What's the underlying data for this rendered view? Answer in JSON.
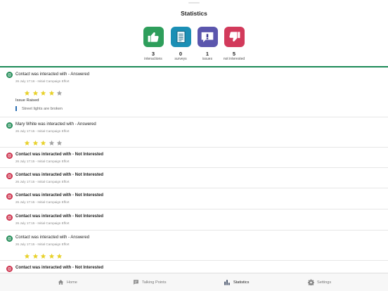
{
  "header": {
    "title": "Statistics"
  },
  "stats": [
    {
      "value": "3",
      "label": "interactions",
      "icon": "thumbs-up-icon",
      "color": "#2e9e5b"
    },
    {
      "value": "0",
      "label": "surveys",
      "icon": "document-icon",
      "color": "#1b8fb5"
    },
    {
      "value": "1",
      "label": "issues",
      "icon": "speech-bubble-icon",
      "color": "#5b56ad"
    },
    {
      "value": "5",
      "label": "not interested",
      "icon": "thumbs-down-icon",
      "color": "#d23a5b"
    }
  ],
  "feed": [
    {
      "headline": "Contact was interacted with - Answered",
      "meta": "26 July 17:16 - Initial Campaign Effort",
      "status": "answered",
      "rating": 4,
      "issue_label": "Issue Raised",
      "issue_text": "Street lights are broken"
    },
    {
      "headline": "Mary White was interacted with - Answered",
      "meta": "26 July 17:15 - Initial Campaign Effort",
      "status": "answered",
      "rating": 3
    },
    {
      "headline": "Contact was interacted with - Not Interested",
      "meta": "26 July 17:15 - Initial Campaign Effort",
      "status": "not-interested"
    },
    {
      "headline": "Contact was interacted with - Not Interested",
      "meta": "26 July 17:15 - Initial Campaign Effort",
      "status": "not-interested"
    },
    {
      "headline": "Contact was interacted with - Not Interested",
      "meta": "26 July 17:15 - Initial Campaign Effort",
      "status": "not-interested"
    },
    {
      "headline": "Contact was interacted with - Not Interested",
      "meta": "26 July 17:15 - Initial Campaign Effort",
      "status": "not-interested"
    },
    {
      "headline": "Contact was interacted with - Answered",
      "meta": "26 July 17:15 - Initial Campaign Effort",
      "status": "answered",
      "rating": 5
    },
    {
      "headline": "Contact was interacted with - Not Interested",
      "meta": "",
      "status": "not-interested"
    }
  ],
  "rating_max": 5,
  "colors": {
    "accent_green": "#1c8a57",
    "answered": "#1f8a55",
    "not_interested": "#cc2f4a",
    "star_on": "#e8d12a",
    "star_off": "#a3a3a3"
  },
  "tabs": [
    {
      "label": "Home",
      "icon": "home-icon",
      "active": false
    },
    {
      "label": "Talking Points",
      "icon": "chat-icon",
      "active": false
    },
    {
      "label": "Statistics",
      "icon": "bar-chart-icon",
      "active": true
    },
    {
      "label": "Settings",
      "icon": "gear-icon",
      "active": false
    }
  ]
}
